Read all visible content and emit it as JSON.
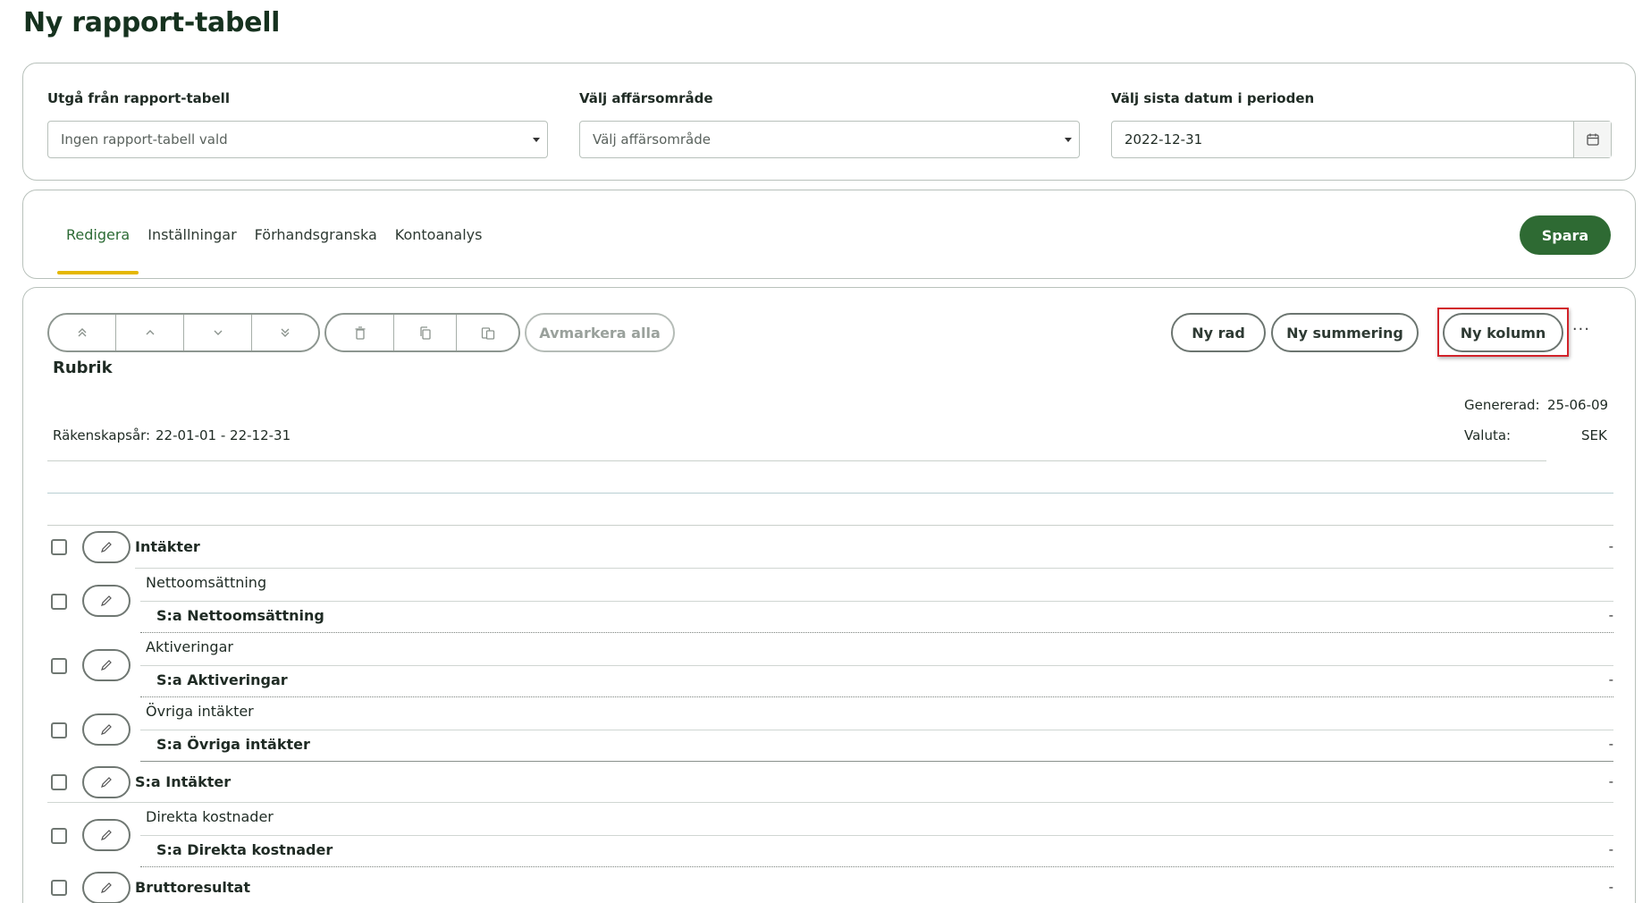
{
  "page": {
    "title": "Ny rapport-tabell"
  },
  "filters": {
    "base_table": {
      "label": "Utgå från rapport-tabell",
      "value": "Ingen rapport-tabell vald"
    },
    "business_area": {
      "label": "Välj affärsområde",
      "value": "Välj affärsområde"
    },
    "period_end": {
      "label": "Välj sista datum i perioden",
      "value": "2022-12-31"
    }
  },
  "tabs": [
    {
      "label": "Redigera",
      "active": true
    },
    {
      "label": "Inställningar",
      "active": false
    },
    {
      "label": "Förhandsgranska",
      "active": false
    },
    {
      "label": "Kontoanalys",
      "active": false
    }
  ],
  "actions": {
    "save_label": "Spara"
  },
  "toolbar": {
    "move_icons": [
      "double-chevron-up-icon",
      "chevron-up-icon",
      "chevron-down-icon",
      "double-chevron-down-icon"
    ],
    "edit_icons": [
      "trash-icon",
      "copy-icon",
      "paste-icon"
    ],
    "deselect_all_label": "Avmarkera alla",
    "new_row_label": "Ny rad",
    "new_sum_label": "Ny summering",
    "new_column_label": "Ny kolumn",
    "more_label": "···"
  },
  "report": {
    "heading": "Rubrik",
    "generated_label": "Genererad:",
    "generated_value": "25-06-09",
    "fiscal_year_label": "Räkenskapsår:",
    "fiscal_year_value": "22-01-01 - 22-12-31",
    "currency_label": "Valuta:",
    "currency_value": "SEK"
  },
  "rows": [
    {
      "label": "Intäkter",
      "sum_label": "",
      "value": "-",
      "sum_value": ""
    },
    {
      "label": "Nettoomsättning",
      "sum_label": "S:a Nettoomsättning",
      "value": "",
      "sum_value": "-"
    },
    {
      "label": "Aktiveringar",
      "sum_label": "S:a Aktiveringar",
      "value": "",
      "sum_value": "-"
    },
    {
      "label": "Övriga intäkter",
      "sum_label": "S:a Övriga intäkter",
      "value": "",
      "sum_value": "-"
    },
    {
      "label": "S:a Intäkter",
      "sum_label": "",
      "value": "-",
      "sum_value": ""
    },
    {
      "label": "Direkta kostnader",
      "sum_label": "S:a Direkta kostnader",
      "value": "",
      "sum_value": "-"
    },
    {
      "label": "Bruttoresultat",
      "sum_label": "",
      "value": "-",
      "sum_value": ""
    }
  ],
  "colors": {
    "brand_green": "#2e6a33",
    "tab_underline": "#e5b800",
    "highlight_red": "#d2232a"
  }
}
